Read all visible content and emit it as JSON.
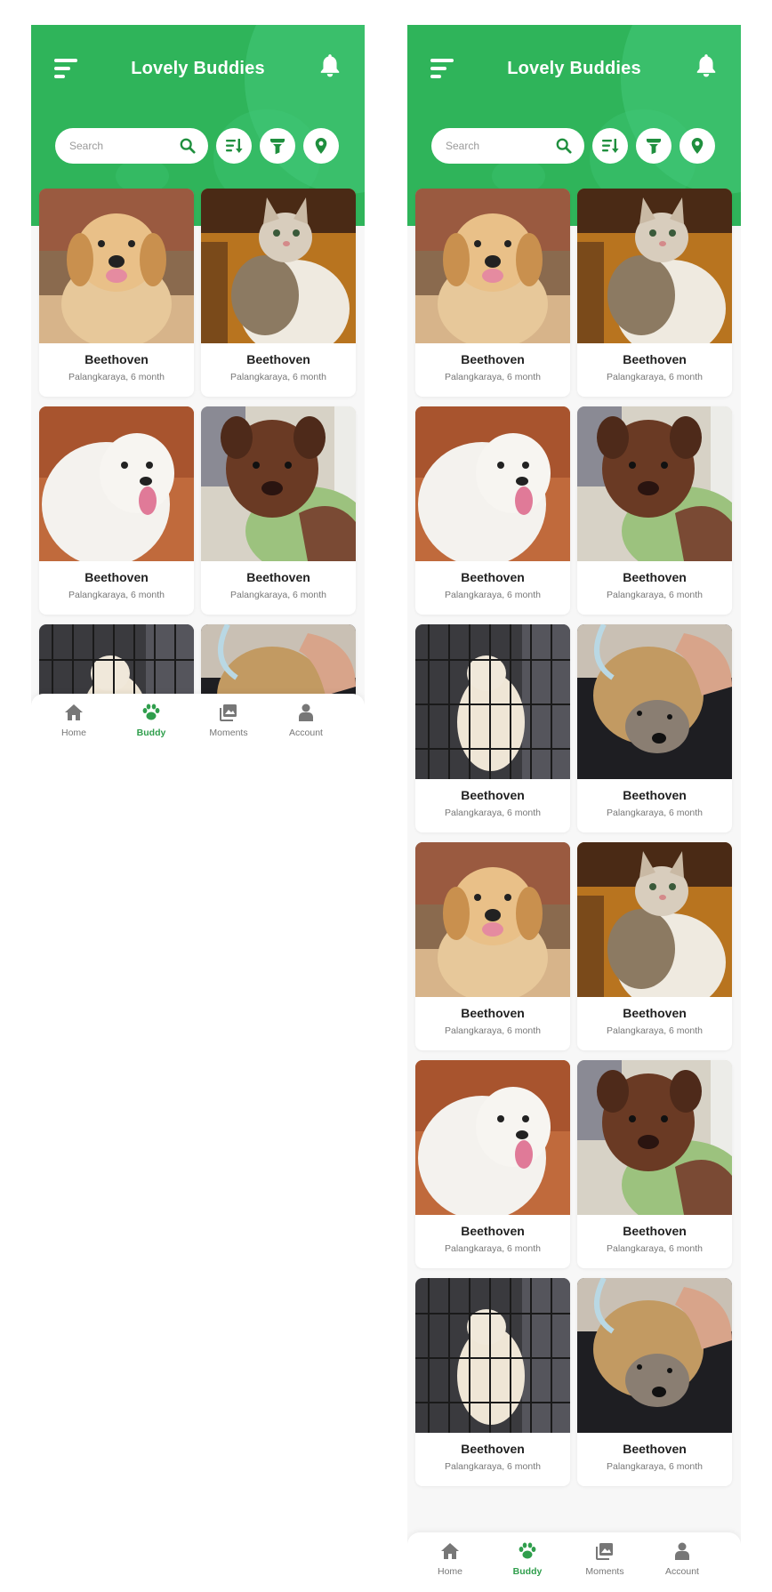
{
  "app": {
    "title": "Lovely Buddies",
    "accent_color": "#2fb45a"
  },
  "search": {
    "placeholder": "Search"
  },
  "header_actions": [
    "menu-icon",
    "bell-icon",
    "search-icon",
    "sort-icon",
    "filter-icon",
    "location-pin-icon"
  ],
  "cards": [
    {
      "name": "Beethoven",
      "meta": "Palangkaraya, 6 month",
      "photo": "golden-retriever-puppy"
    },
    {
      "name": "Beethoven",
      "meta": "Palangkaraya, 6 month",
      "photo": "tabby-white-cat"
    },
    {
      "name": "Beethoven",
      "meta": "Palangkaraya, 6 month",
      "photo": "white-fluffy-puppy"
    },
    {
      "name": "Beethoven",
      "meta": "Palangkaraya, 6 month",
      "photo": "brown-puppy"
    },
    {
      "name": "Beethoven",
      "meta": "Palangkaraya, 6 month",
      "photo": "white-cat-in-cage"
    },
    {
      "name": "Beethoven",
      "meta": "Palangkaraya, 6 month",
      "photo": "scruffy-terrier"
    }
  ],
  "nav": [
    {
      "label": "Home",
      "icon": "home-icon",
      "active": false
    },
    {
      "label": "Buddy",
      "icon": "paw-icon",
      "active": true
    },
    {
      "label": "Moments",
      "icon": "photos-icon",
      "active": false
    },
    {
      "label": "Account",
      "icon": "person-icon",
      "active": false
    }
  ]
}
